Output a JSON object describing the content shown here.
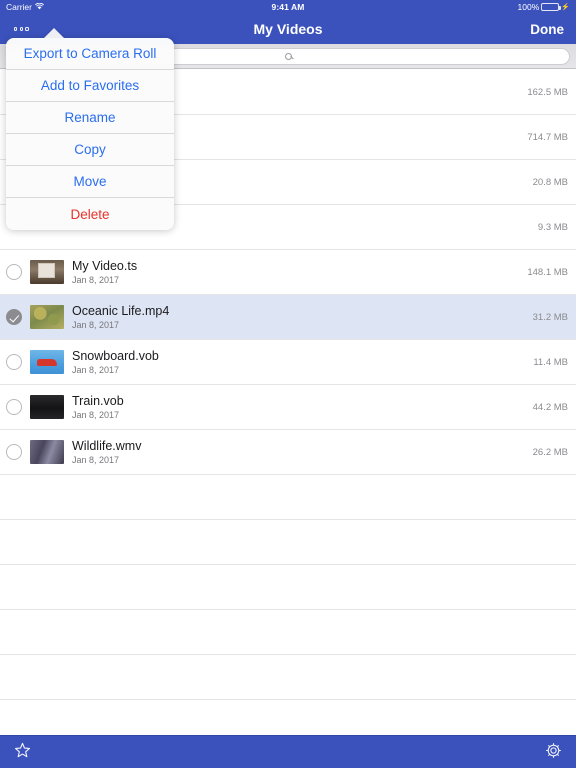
{
  "status_bar": {
    "carrier": "Carrier",
    "wifi_icon": "wifi-icon",
    "time": "9:41 AM",
    "battery_percent": "100%",
    "battery_icon": "battery-full-icon",
    "charging_icon": "charging-bolt-icon"
  },
  "nav_bar": {
    "more_button": "more-options-button",
    "title": "My Videos",
    "done_label": "Done"
  },
  "search": {
    "placeholder": "",
    "value": "",
    "icon": "search-icon"
  },
  "popover": {
    "items": [
      {
        "label": "Export to Camera Roll",
        "style": "default"
      },
      {
        "label": "Add to Favorites",
        "style": "default"
      },
      {
        "label": "Rename",
        "style": "default"
      },
      {
        "label": "Copy",
        "style": "default"
      },
      {
        "label": "Move",
        "style": "default"
      },
      {
        "label": "Delete",
        "style": "destructive"
      }
    ]
  },
  "colors": {
    "nav_blue": "#3b52bd",
    "link_blue": "#2a6ef0",
    "destructive_red": "#e8322b",
    "selected_row": "#dde4f3",
    "battery_green": "#4cd964"
  },
  "file_list": {
    "rows": [
      {
        "name": "",
        "date": "",
        "size": "162.5 MB",
        "selected": false,
        "thumb": "thumb-hidden",
        "hidden_behind_popover": true
      },
      {
        "name": "",
        "date": "",
        "size": "714.7 MB",
        "selected": false,
        "thumb": "thumb-hidden",
        "hidden_behind_popover": true
      },
      {
        "name": "",
        "date": "",
        "size": "20.8 MB",
        "selected": false,
        "thumb": "thumb-hidden",
        "hidden_behind_popover": true
      },
      {
        "name": "",
        "date": "",
        "size": "9.3 MB",
        "selected": false,
        "thumb": "thumb-hidden",
        "hidden_behind_popover": true
      },
      {
        "name": "My Video.ts",
        "date": "Jan 8, 2017",
        "size": "148.1 MB",
        "selected": false,
        "thumb": "thumb-ts"
      },
      {
        "name": "Oceanic Life.mp4",
        "date": "Jan 8, 2017",
        "size": "31.2 MB",
        "selected": true,
        "thumb": "thumb-ocean"
      },
      {
        "name": "Snowboard.vob",
        "date": "Jan 8, 2017",
        "size": "11.4 MB",
        "selected": false,
        "thumb": "thumb-snow"
      },
      {
        "name": "Train.vob",
        "date": "Jan 8, 2017",
        "size": "44.2 MB",
        "selected": false,
        "thumb": "thumb-train"
      },
      {
        "name": "Wildlife.wmv",
        "date": "Jan 8, 2017",
        "size": "26.2 MB",
        "selected": false,
        "thumb": "thumb-wild"
      }
    ],
    "empty_row_count": 6
  },
  "toolbar": {
    "favorites_icon": "star-icon",
    "settings_icon": "gear-icon"
  }
}
